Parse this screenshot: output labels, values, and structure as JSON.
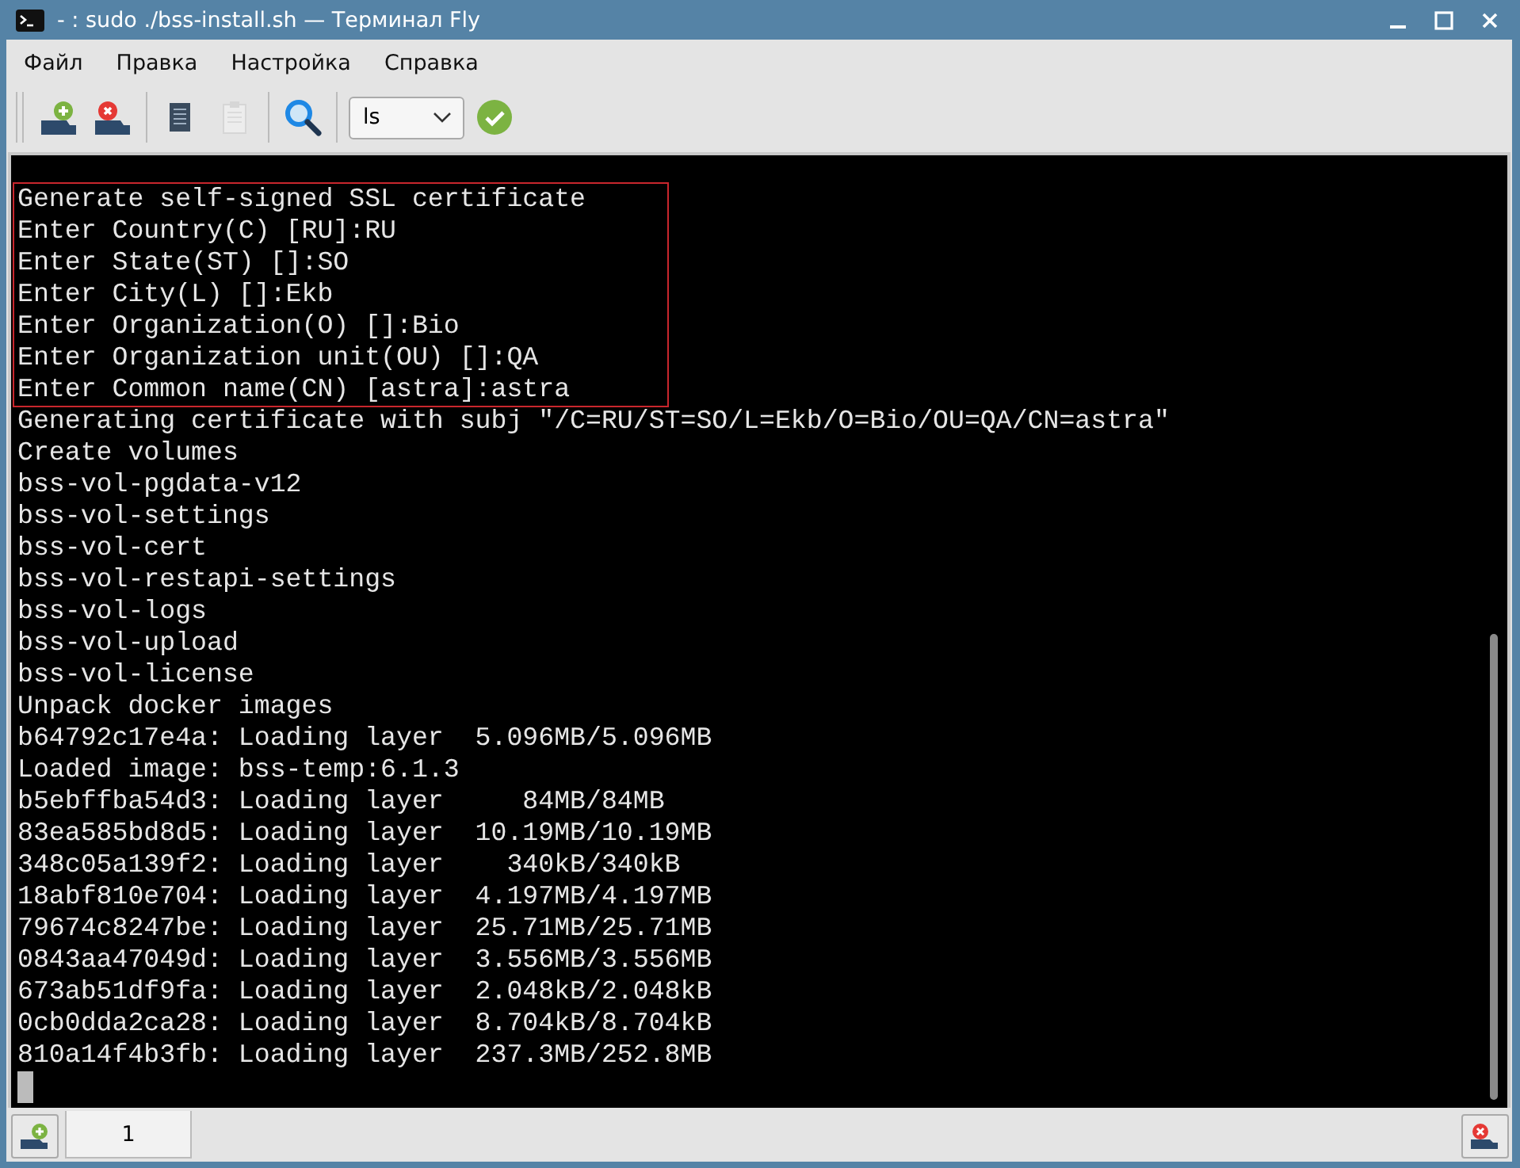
{
  "window": {
    "title": "- : sudo ./bss-install.sh — Терминал Fly"
  },
  "menu": [
    "Файл",
    "Правка",
    "Настройка",
    "Справка"
  ],
  "toolbar": {
    "buttons": [
      {
        "kind": "new-tab",
        "disabled": false
      },
      {
        "kind": "close-tab",
        "disabled": false
      },
      {
        "kind": "copy",
        "disabled": false
      },
      {
        "kind": "paste",
        "disabled": true
      },
      {
        "kind": "search",
        "disabled": false
      }
    ],
    "command": {
      "value": "ls"
    }
  },
  "terminal": {
    "blocks": [
      {
        "highlighted": true,
        "lines": [
          "Generate self-signed SSL certificate",
          "Enter Country(C) [RU]:RU",
          "Enter State(ST) []:SO",
          "Enter City(L) []:Ekb",
          "Enter Organization(O) []:Bio",
          "Enter Organization unit(OU) []:QA",
          "Enter Common name(CN) [astra]:astra"
        ]
      },
      {
        "highlighted": false,
        "lines": [
          "Generating certificate with subj \"/C=RU/ST=SO/L=Ekb/O=Bio/OU=QA/CN=astra\"",
          "Create volumes",
          "bss-vol-pgdata-v12",
          "bss-vol-settings",
          "bss-vol-cert",
          "bss-vol-restapi-settings",
          "bss-vol-logs",
          "bss-vol-upload",
          "bss-vol-license",
          "Unpack docker images",
          "b64792c17e4a: Loading layer  5.096MB/5.096MB",
          "Loaded image: bss-temp:6.1.3",
          "b5ebffba54d3: Loading layer     84MB/84MB",
          "83ea585bd8d5: Loading layer  10.19MB/10.19MB",
          "348c05a139f2: Loading layer    340kB/340kB",
          "18abf810e704: Loading layer  4.197MB/4.197MB",
          "79674c8247be: Loading layer  25.71MB/25.71MB",
          "0843aa47049d: Loading layer  3.556MB/3.556MB",
          "673ab51df9fa: Loading layer  2.048kB/2.048kB",
          "0cb0dda2ca28: Loading layer  8.704kB/8.704kB",
          "810a14f4b3fb: Loading layer  237.3MB/252.8MB"
        ]
      }
    ]
  },
  "tabs": [
    {
      "label": "1",
      "selected": true
    }
  ]
}
